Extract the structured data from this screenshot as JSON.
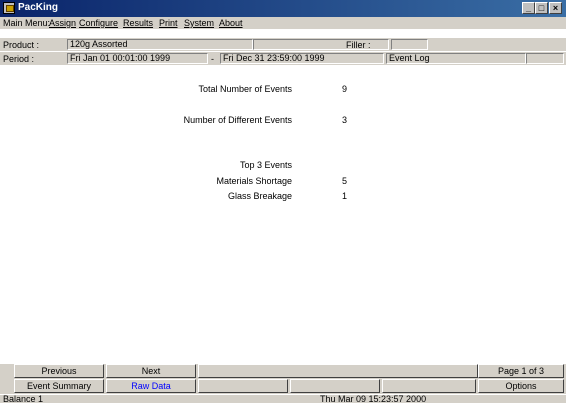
{
  "window": {
    "title": "PacKing"
  },
  "menu": {
    "label": "Main Menu:",
    "items": [
      "Assign",
      "Configure",
      "Results",
      "Print",
      "System",
      "About"
    ]
  },
  "product": {
    "label": "Product :",
    "value": "120g Assorted",
    "filler_label": "Filler :",
    "filler_value": ""
  },
  "period": {
    "label": "Period :",
    "start": "Fri Jan 01 00:01:00 1999",
    "separator": "-",
    "end": "Fri Dec 31 23:59:00 1999",
    "report": "Event Log"
  },
  "stats": {
    "total_label": "Total Number of Events",
    "total_value": "9",
    "different_label": "Number of Different Events",
    "different_value": "3",
    "top_label": "Top 3 Events",
    "events": [
      {
        "name": "Materials Shortage",
        "count": "5"
      },
      {
        "name": "Glass Breakage",
        "count": "1"
      }
    ]
  },
  "nav": {
    "previous": "Previous",
    "next": "Next",
    "page": "Page 1 of 3"
  },
  "tabs": {
    "event_summary": "Event Summary",
    "raw_data": "Raw Data",
    "options": "Options"
  },
  "status": {
    "left": "Balance 1",
    "datetime": "Thu Mar 09 15:23:57 2000"
  },
  "colors": {
    "titlebar": "#0a246a",
    "face": "#d4d0c8",
    "active_tab_text": "#0000ff"
  }
}
